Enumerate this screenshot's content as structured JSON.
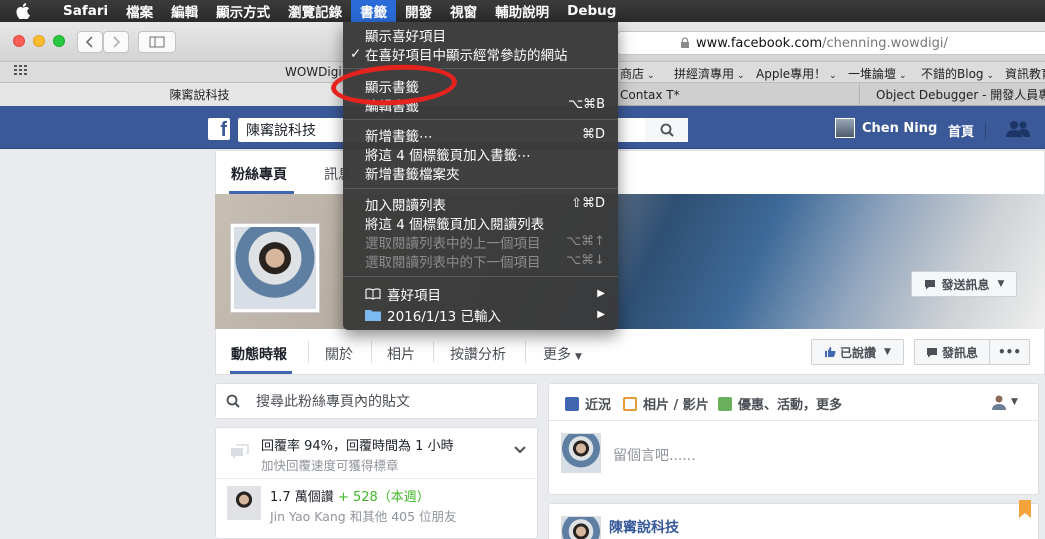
{
  "menubar": {
    "app": "Safari",
    "items": [
      "檔案",
      "編輯",
      "顯示方式",
      "瀏覽記錄",
      "書籤",
      "開發",
      "視窗",
      "輔助說明",
      "Debug"
    ],
    "active_index": 4
  },
  "toolbar": {
    "url_host": "www.facebook.com",
    "url_path": "/chenning.wowdigi/"
  },
  "bookmarks_bar": [
    {
      "label": "WOWDigi"
    },
    {
      "label": "商店",
      "dropdown": true
    },
    {
      "label": "拼經濟專用",
      "dropdown": true
    },
    {
      "label": "Apple專用！",
      "dropdown": true
    },
    {
      "label": "一堆論壇",
      "dropdown": true
    },
    {
      "label": "不錯的Blog",
      "dropdown": true
    },
    {
      "label": "資訊教育"
    }
  ],
  "tabs": [
    {
      "label": "陳寗說科技",
      "active": true
    },
    {
      "label": "Contax T*",
      "active": false
    },
    {
      "label": "Object Debugger - 開發人員專用",
      "active": false
    }
  ],
  "bookmarks_menu": {
    "items": [
      {
        "label": "顯示喜好項目",
        "shortcut": "",
        "disabled": false,
        "checked": false
      },
      {
        "label": "在喜好項目中顯示經常參訪的網站",
        "shortcut": "",
        "disabled": false,
        "checked": true
      },
      {
        "label": "顯示書籤",
        "shortcut": "",
        "disabled": false,
        "checked": false
      },
      {
        "label": "編輯書籤",
        "shortcut": "⌥⌘B",
        "disabled": false,
        "checked": false
      },
      {
        "label": "新增書籤⋯",
        "shortcut": "⌘D",
        "disabled": false,
        "checked": false
      },
      {
        "label": "將這 4 個標籤頁加入書籤⋯",
        "shortcut": "",
        "disabled": false,
        "checked": false
      },
      {
        "label": "新增書籤檔案夾",
        "shortcut": "",
        "disabled": false,
        "checked": false
      },
      {
        "label": "加入閱讀列表",
        "shortcut": "⇧⌘D",
        "disabled": false,
        "checked": false
      },
      {
        "label": "將這 4 個標籤頁加入閱讀列表",
        "shortcut": "",
        "disabled": false,
        "checked": false
      },
      {
        "label": "選取閱讀列表中的上一個項目",
        "shortcut": "⌥⌘↑",
        "disabled": true,
        "checked": false
      },
      {
        "label": "選取閱讀列表中的下一個項目",
        "shortcut": "⌥⌘↓",
        "disabled": true,
        "checked": false
      },
      {
        "label": "喜好項目",
        "shortcut": "",
        "disabled": false,
        "checked": false,
        "submenu": true,
        "icon": "book-icon"
      },
      {
        "label": "2016/1/13 已輸入",
        "shortcut": "",
        "disabled": false,
        "checked": false,
        "submenu": true,
        "icon": "folder-icon"
      }
    ],
    "highlight_color": "#e4231f"
  },
  "facebook": {
    "brand_color": "#3b5998",
    "search_value": "陳寗說科技",
    "user_name": "Chen Ning",
    "home": "首頁",
    "page_tabs": [
      "粉絲專頁",
      "訊息"
    ],
    "cover_button": "發送訊息",
    "subnav": [
      "動態時報",
      "關於",
      "相片",
      "按讚分析",
      "更多"
    ],
    "liked_button": "已說讚",
    "message_button": "發訊息",
    "more_button": "•••",
    "search_posts_placeholder": "搜尋此粉絲專頁內的貼文",
    "response_rate": "回覆率 94%，回覆時間為 1 小時",
    "response_hint": "加快回覆速度可獲得標章",
    "likes_total": "1.7 萬個讚",
    "likes_new": "+ 528",
    "likes_period": "（本週）",
    "likes_friends": "Jin Yao Kang 和其他 405 位朋友",
    "composer_tabs": [
      "近況",
      "相片 / 影片",
      "優惠、活動，更多"
    ],
    "composer_placeholder": "留個言吧......",
    "post_author": "陳寗說科技"
  }
}
